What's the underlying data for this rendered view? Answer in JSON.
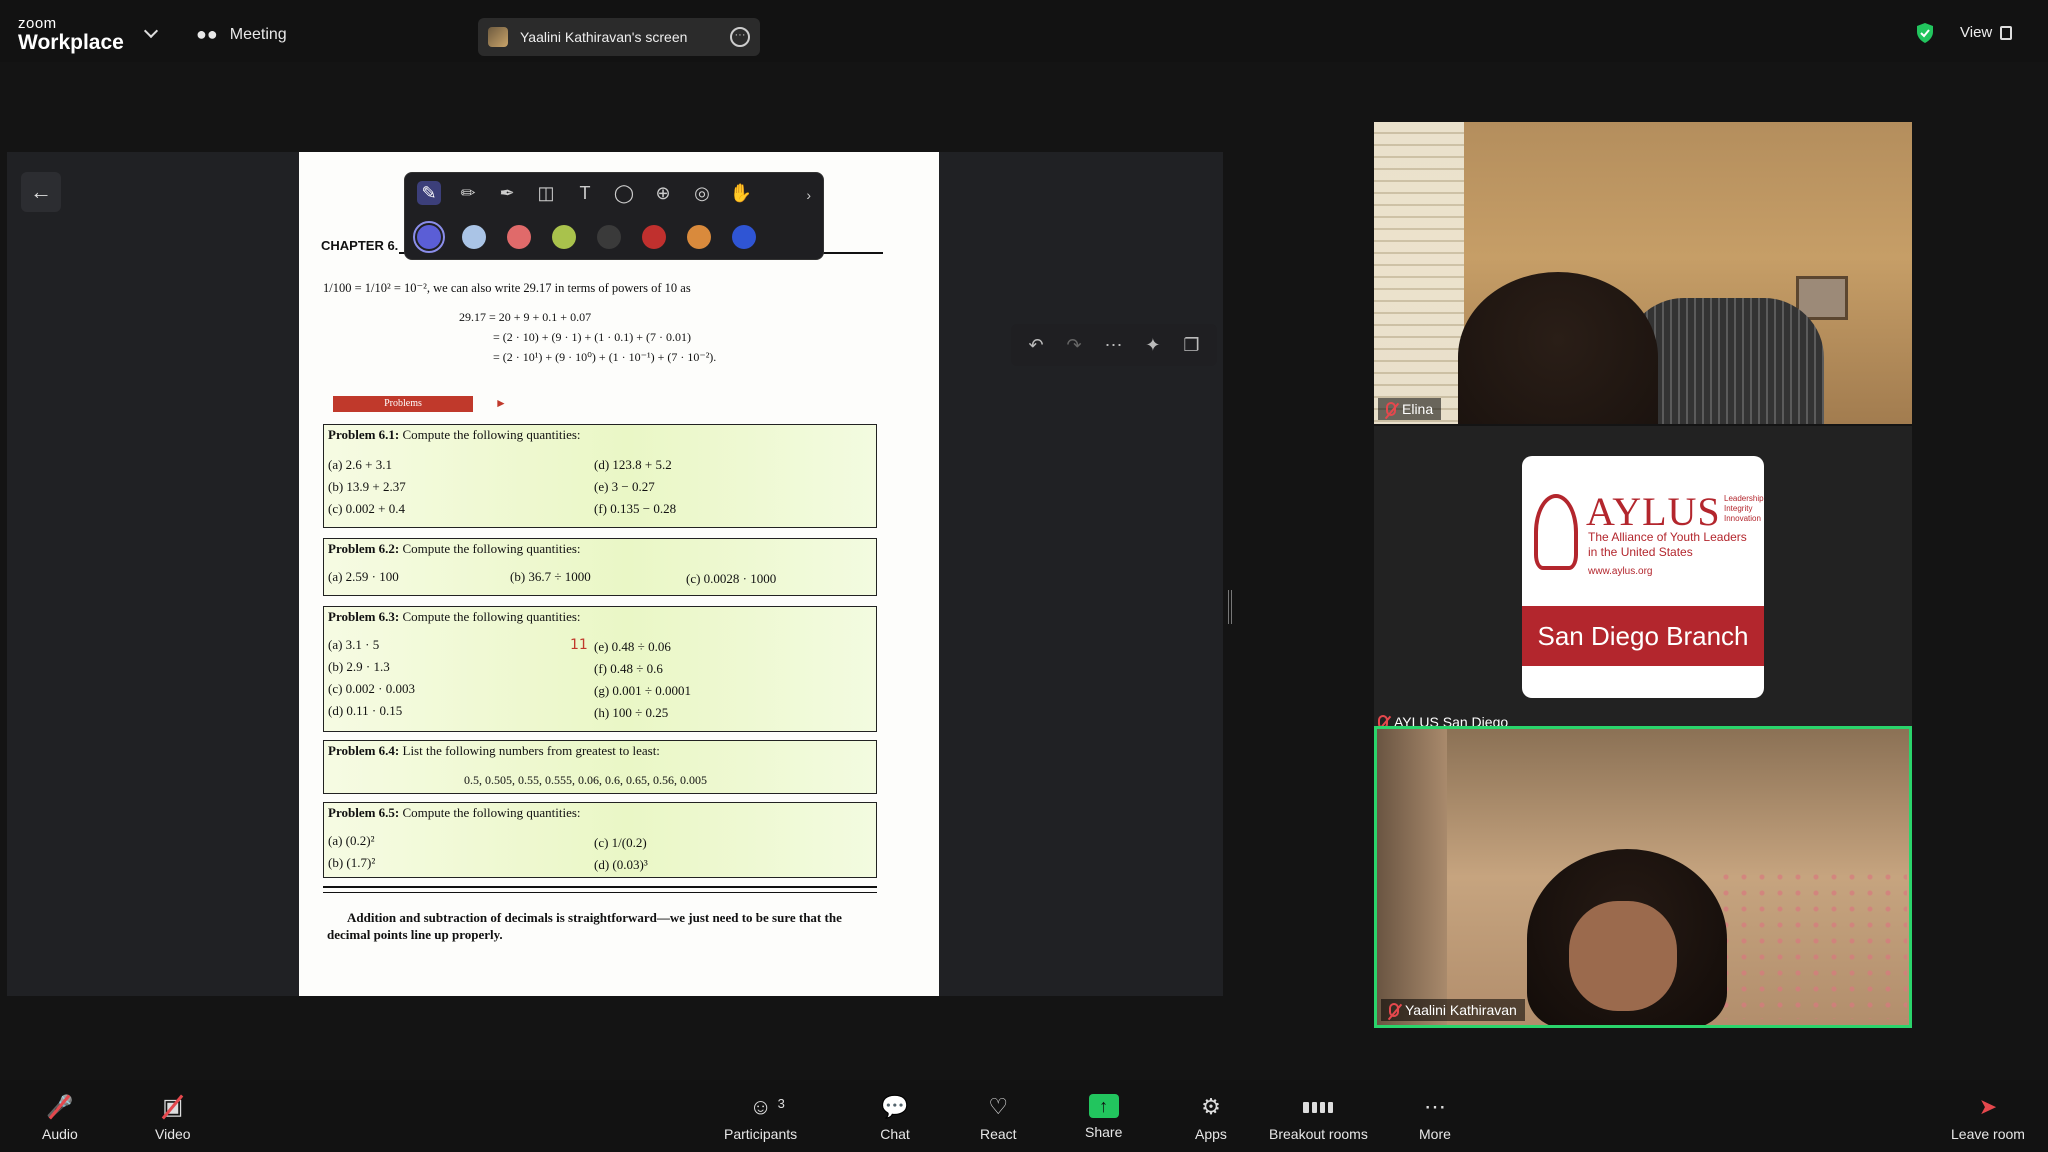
{
  "topbar": {
    "logo_small": "zoom",
    "logo_big": "Workplace",
    "meeting_label": "Meeting",
    "screen_share_label": "Yaalini Kathiravan's screen",
    "view_label": "View"
  },
  "share": {
    "annotation_tools": [
      "pen-icon",
      "pencil-icon",
      "highlighter-icon",
      "eraser-icon",
      "text-icon",
      "lasso-icon",
      "add-icon",
      "mic-icon",
      "hand-icon"
    ],
    "annotation_colors": [
      "#5b5ed6",
      "#aac4e6",
      "#e06a6a",
      "#a9c24c",
      "#3a3a3a",
      "#c0302e",
      "#d98a3c",
      "#2f55d4"
    ],
    "right_tools": [
      "undo-icon",
      "redo-icon",
      "more-icon",
      "magic-icon",
      "copy-icon"
    ]
  },
  "book": {
    "chapter": "CHAPTER 6.",
    "intro": "1/100 = 1/10² = 10⁻², we can also write 29.17 in terms of powers of 10 as",
    "eq1": "29.17 = 20 + 9 + 0.1 + 0.07",
    "eq2": "= (2 · 10) + (9 · 1) + (1 · 0.1) + (7 · 0.01)",
    "eq3": "= (2 · 10¹) + (9 · 10⁰) + (1 · 10⁻¹) + (7 · 10⁻²).",
    "problems_tag": "Problems",
    "p1": {
      "title": "Problem 6.1:",
      "text": "Compute the following quantities:",
      "items": [
        "(a)  2.6 + 3.1",
        "(b)  13.9 + 2.37",
        "(c)  0.002 + 0.4",
        "(d)  123.8 + 5.2",
        "(e)  3 − 0.27",
        "(f)  0.135 − 0.28"
      ]
    },
    "p2": {
      "title": "Problem 6.2:",
      "text": "Compute the following quantities:",
      "items": [
        "(a)  2.59 · 100",
        "(b)  36.7 ÷ 1000",
        "(c)  0.0028 · 1000"
      ]
    },
    "p3": {
      "title": "Problem 6.3:",
      "text": "Compute the following quantities:",
      "items": [
        "(a)  3.1 · 5",
        "(b)  2.9 · 1.3",
        "(c)  0.002 · 0.003",
        "(d)  0.11 · 0.15",
        "(e)  0.48 ÷ 0.06",
        "(f)  0.48 ÷ 0.6",
        "(g)  0.001 ÷ 0.0001",
        "(h)  100 ÷ 0.25"
      ],
      "handwritten": "11"
    },
    "p4": {
      "title": "Problem 6.4:",
      "text": "List the following numbers from greatest to least:",
      "list": "0.5, 0.505, 0.55, 0.555, 0.06, 0.6, 0.65, 0.56, 0.005"
    },
    "p5": {
      "title": "Problem 6.5:",
      "text": "Compute the following quantities:",
      "items": [
        "(a)  (0.2)²",
        "(b)  (1.7)²",
        "(c)  1/(0.2)",
        "(d)  (0.03)³"
      ]
    },
    "footer1": "Addition and subtraction of decimals is straightforward—we just need to be sure that the",
    "footer2": "decimal points line up properly."
  },
  "participants_tiles": [
    {
      "name": "Elina",
      "muted": true
    },
    {
      "name": "AYLUS San Diego",
      "muted": true
    },
    {
      "name": "Yaalini Kathiravan",
      "muted": true,
      "active_speaker": true
    }
  ],
  "aylus_logo": {
    "brand": "AYLUS",
    "tagline": "Leadership Integrity Innovation",
    "subtitle": "The Alliance of Youth Leaders in the United States",
    "url": "www.aylus.org",
    "branch": "San Diego Branch"
  },
  "bottombar": {
    "audio": "Audio",
    "video": "Video",
    "participants": "Participants",
    "participants_count": "3",
    "chat": "Chat",
    "react": "React",
    "share": "Share",
    "apps": "Apps",
    "breakout": "Breakout rooms",
    "more": "More",
    "leave": "Leave room"
  }
}
